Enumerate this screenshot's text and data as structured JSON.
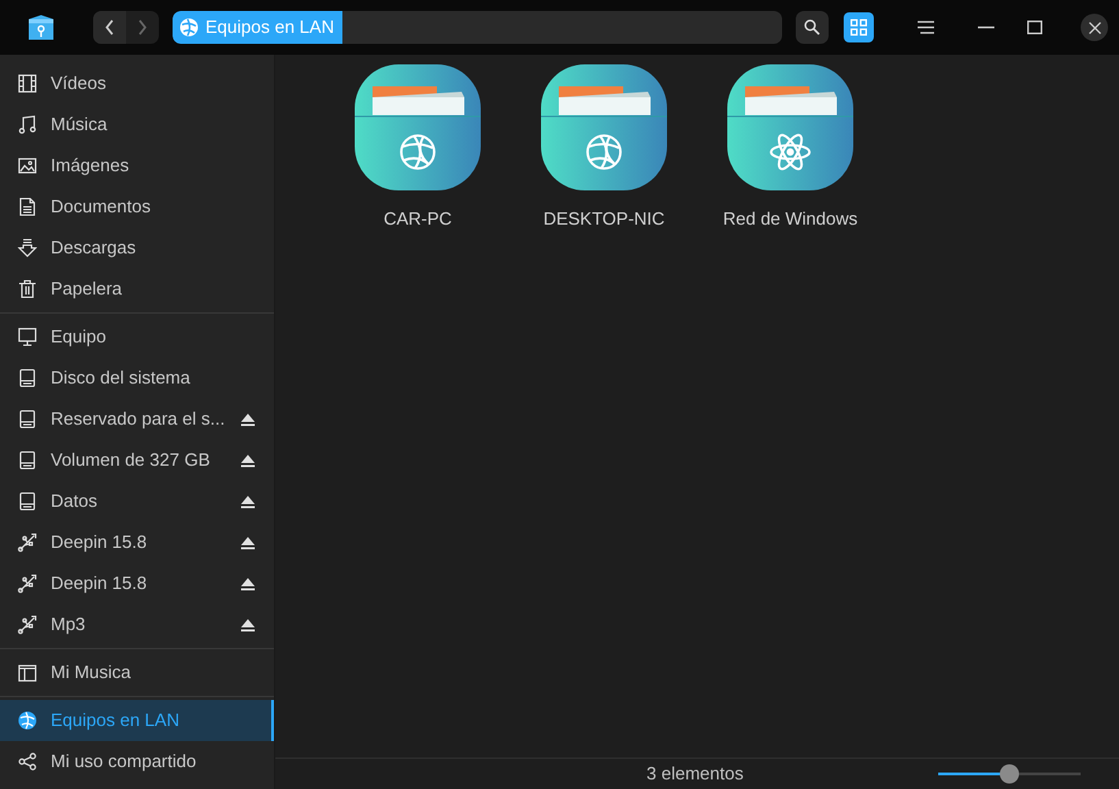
{
  "titlebar": {
    "address": "Equipos en LAN",
    "view_grid_selected": true
  },
  "sidebar": {
    "groups": [
      {
        "items": [
          {
            "kind": "film",
            "label": "Vídeos",
            "selected": false,
            "ejectable": false
          },
          {
            "kind": "music",
            "label": "Música",
            "selected": false,
            "ejectable": false
          },
          {
            "kind": "image",
            "label": "Imágenes",
            "selected": false,
            "ejectable": false
          },
          {
            "kind": "document",
            "label": "Documentos",
            "selected": false,
            "ejectable": false
          },
          {
            "kind": "download",
            "label": "Descargas",
            "selected": false,
            "ejectable": false
          },
          {
            "kind": "trash",
            "label": "Papelera",
            "selected": false,
            "ejectable": false
          }
        ]
      },
      {
        "items": [
          {
            "kind": "computer",
            "label": "Equipo",
            "selected": false,
            "ejectable": false
          },
          {
            "kind": "disk",
            "label": "Disco del sistema",
            "selected": false,
            "ejectable": false
          },
          {
            "kind": "disk",
            "label": "Reservado para el s...",
            "selected": false,
            "ejectable": true
          },
          {
            "kind": "disk",
            "label": "Volumen de 327 GB",
            "selected": false,
            "ejectable": true
          },
          {
            "kind": "disk",
            "label": "Datos",
            "selected": false,
            "ejectable": true
          },
          {
            "kind": "usb",
            "label": "Deepin 15.8",
            "selected": false,
            "ejectable": true
          },
          {
            "kind": "usb",
            "label": "Deepin 15.8",
            "selected": false,
            "ejectable": true
          },
          {
            "kind": "usb",
            "label": "Mp3",
            "selected": false,
            "ejectable": true
          }
        ]
      },
      {
        "items": [
          {
            "kind": "folder",
            "label": "Mi Musica",
            "selected": false,
            "ejectable": false
          }
        ]
      },
      {
        "items": [
          {
            "kind": "network",
            "label": "Equipos en LAN",
            "selected": true,
            "ejectable": false
          },
          {
            "kind": "share",
            "label": "Mi uso compartido",
            "selected": false,
            "ejectable": false
          }
        ]
      }
    ]
  },
  "files": [
    {
      "kind": "network",
      "name": "CAR-PC"
    },
    {
      "kind": "network",
      "name": "DESKTOP-NIC"
    },
    {
      "kind": "atom",
      "name": "Red de Windows"
    }
  ],
  "status_bar": {
    "count": "3 elementos",
    "zoom": {
      "level": 0.5
    }
  }
}
